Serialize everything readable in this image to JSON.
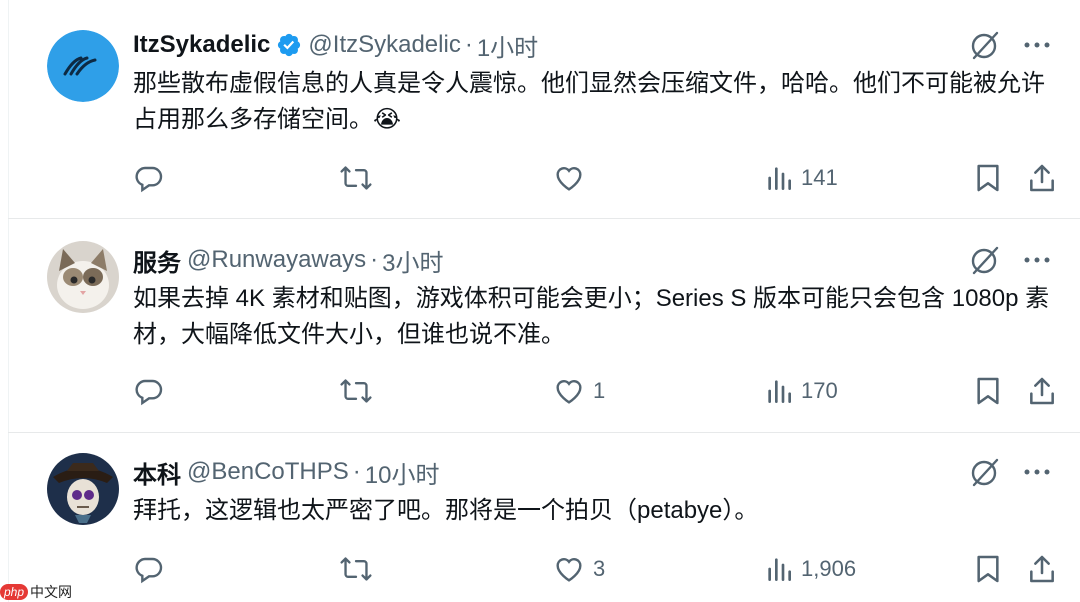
{
  "tweets": [
    {
      "author": "ItzSykadelic",
      "verified": true,
      "handle": "@ItzSykadelic",
      "sep": "·",
      "time": "1小时",
      "text": "那些散布虚假信息的人真是令人震惊。他们显然会压缩文件，哈哈。他们不可能被允许占用那么多存储空间。😭",
      "replies": "",
      "retweets": "",
      "likes": "",
      "views": "141",
      "avatar_icon": "sykadelic-logo-avatar"
    },
    {
      "author": "服务",
      "verified": false,
      "handle": "@Runwayaways",
      "sep": "·",
      "time": "3小时",
      "text": "如果去掉 4K 素材和贴图，游戏体积可能会更小；Series S 版本可能只会包含 1080p 素材，大幅降低文件大小，但谁也说不准。",
      "replies": "",
      "retweets": "",
      "likes": "1",
      "views": "170",
      "avatar_icon": "cat-photo-avatar"
    },
    {
      "author": "本科",
      "verified": false,
      "handle": "@BenCoTHPS",
      "sep": "·",
      "time": "10小时",
      "text": "拜托，这逻辑也太严密了吧。那将是一个拍贝（petabye）。",
      "replies": "",
      "retweets": "",
      "likes": "3",
      "views": "1,906",
      "avatar_icon": "pirate-skull-avatar"
    }
  ],
  "watermark": {
    "badge": "php",
    "text": "中文网"
  },
  "colors": {
    "text": "#0f1419",
    "secondary": "#536471",
    "verified": "#1d9bf0",
    "divider": "#e7e9ea"
  }
}
